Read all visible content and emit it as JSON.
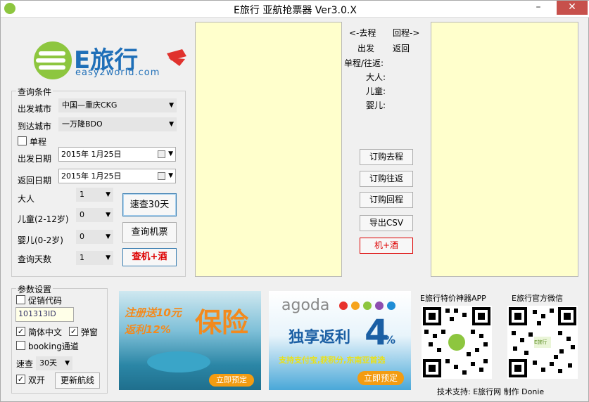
{
  "window": {
    "title": "E旅行 亚航抢票器  Ver3.0.X"
  },
  "logo": {
    "brand": "E旅行",
    "domain": "easy2world.com"
  },
  "query": {
    "group_label": "查询条件",
    "from_label": "出发城市",
    "from_value": "中国—重庆CKG",
    "to_label": "到达城市",
    "to_value": "一万隆BDO",
    "oneway_label": "单程",
    "depart_label": "出发日期",
    "depart_value": "2015年  1月25日",
    "return_label": "返回日期",
    "return_value": "2015年  1月25日",
    "adult_label": "大人",
    "adult_value": "1",
    "child_label": "儿童(2-12岁)",
    "child_value": "0",
    "infant_label": "婴儿(0-2岁)",
    "infant_value": "0",
    "days_label": "查询天数",
    "days_value": "1",
    "btn_quick30": "速查30天",
    "btn_search": "查询机票",
    "btn_hotel": "查机+酒"
  },
  "summary": {
    "outbound_arrow": "<-去程",
    "return_arrow": "回程->",
    "depart": "出发",
    "return": "返回",
    "price_label": "单程/往返:",
    "adult": "大人:",
    "child": "儿童:",
    "infant": "婴儿:",
    "btn_book_out": "订购去程",
    "btn_book_round": "订购往返",
    "btn_book_return": "订购回程",
    "btn_export": "导出CSV",
    "btn_flight_hotel": "机+酒"
  },
  "params": {
    "group_label": "参数设置",
    "promo_label": "促销代码",
    "promo_value": "101313ID",
    "simplified_label": "简体中文",
    "popup_label": "弹窗",
    "booking_label": "booking通道",
    "speed_label": "速查",
    "speed_value": "30天",
    "dual_label": "双开",
    "btn_update": "更新航线"
  },
  "ads": {
    "insurance_line1": "注册送10元",
    "insurance_line2": "返利12%",
    "insurance_big": "保险",
    "insurance_cta": "立即预定",
    "agoda_brand": "agoda",
    "agoda_line": "独享返利",
    "agoda_big": "4",
    "agoda_pct": "%",
    "agoda_sub": "支持支付宝,获积分,东南亚首选",
    "agoda_cta": "立即预定"
  },
  "qr": {
    "app_label": "E旅行特价神器APP",
    "wechat_label": "E旅行官方微信",
    "center_text": "E旅行"
  },
  "footer": {
    "credit": "技术支持: E旅行网  制作 Donie"
  },
  "colors": {
    "panel_bg": "#ffffcc",
    "accent_red": "#dd0000",
    "brand_green": "#8dc63f"
  }
}
